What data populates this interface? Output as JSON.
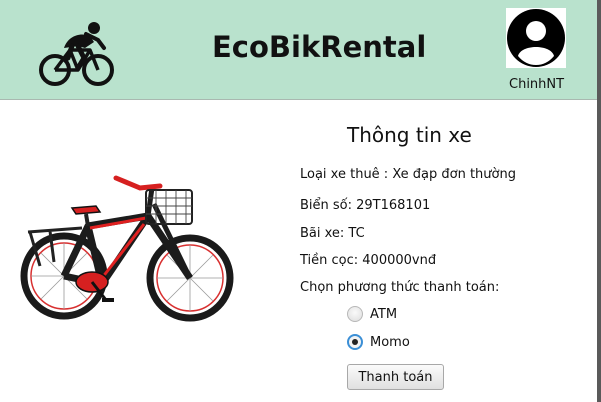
{
  "header": {
    "app_title": "EcoBikRental",
    "username": "ChinhNT",
    "background_color": "#b9e2cd"
  },
  "icons": {
    "logo": "cyclist-logo-icon",
    "avatar": "user-avatar-icon"
  },
  "details": {
    "title": "Thông tin xe",
    "bike_type": "Loại xe thuê : Xe đạp đơn thường",
    "license_plate": "Biển số: 29T168101",
    "station": "Bãi xe: TC",
    "deposit": "Tiền cọc: 400000vnđ",
    "payment_prompt": "Chọn phương thức thanh toán:"
  },
  "payment": {
    "options": [
      {
        "label": "ATM",
        "selected": false
      },
      {
        "label": "Momo",
        "selected": true
      }
    ],
    "submit_label": "Thanh toán"
  },
  "colors": {
    "bike_frame": "#e02020",
    "radio_focus": "#3b8fd6"
  }
}
